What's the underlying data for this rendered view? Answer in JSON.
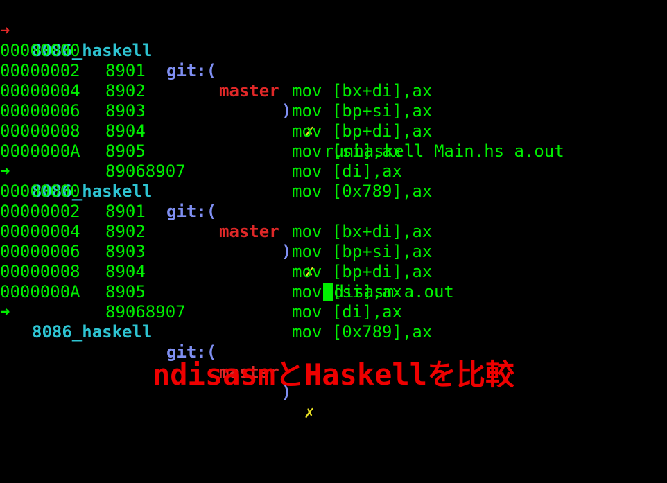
{
  "colors": {
    "background": "#000000",
    "output_text": "#00ee00",
    "prompt_arrow_error": "#e02828",
    "prompt_arrow_ok": "#00ee00",
    "directory": "#2ec4d2",
    "git_label": "#7f8ff2",
    "branch": "#e02828",
    "dirty_marker": "#e8e024",
    "caption": "#ee0000"
  },
  "prompts": [
    {
      "arrow": "➜",
      "arrow_status": "error",
      "directory": "8086_haskell",
      "git_label": "git:(",
      "branch": "master",
      "git_close": ")",
      "dirty_marker": "✗",
      "command": "runhaskell Main.hs a.out"
    },
    {
      "arrow": "➜",
      "arrow_status": "ok",
      "directory": "8086_haskell",
      "git_label": "git:(",
      "branch": "master",
      "git_close": ")",
      "dirty_marker": "✗",
      "command": "ndisasm a.out"
    },
    {
      "arrow": "➜",
      "arrow_status": "ok",
      "directory": "8086_haskell",
      "git_label": "git:(",
      "branch": "master",
      "git_close": ")",
      "dirty_marker": "✗",
      "command": ""
    }
  ],
  "outputs": [
    [
      {
        "address": "00000000",
        "hex": "8901",
        "asm": "mov [bx+di],ax"
      },
      {
        "address": "00000002",
        "hex": "8902",
        "asm": "mov [bp+si],ax"
      },
      {
        "address": "00000004",
        "hex": "8903",
        "asm": "mov [bp+di],ax"
      },
      {
        "address": "00000006",
        "hex": "8904",
        "asm": "mov [si],ax"
      },
      {
        "address": "00000008",
        "hex": "8905",
        "asm": "mov [di],ax"
      },
      {
        "address": "0000000A",
        "hex": "89068907",
        "asm": "mov [0x789],ax"
      }
    ],
    [
      {
        "address": "00000000",
        "hex": "8901",
        "asm": "mov [bx+di],ax"
      },
      {
        "address": "00000002",
        "hex": "8902",
        "asm": "mov [bp+si],ax"
      },
      {
        "address": "00000004",
        "hex": "8903",
        "asm": "mov [bp+di],ax"
      },
      {
        "address": "00000006",
        "hex": "8904",
        "asm": "mov [si],ax"
      },
      {
        "address": "00000008",
        "hex": "8905",
        "asm": "mov [di],ax"
      },
      {
        "address": "0000000A",
        "hex": "89068907",
        "asm": "mov [0x789],ax"
      }
    ]
  ],
  "caption": "ndisasmとHaskellを比較"
}
